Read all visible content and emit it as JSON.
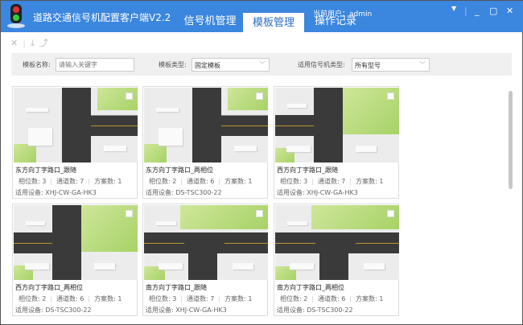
{
  "header": {
    "title": "道路交通信号机配置客户端V2.2",
    "tabs": [
      {
        "label": "信号机管理",
        "active": false
      },
      {
        "label": "模板管理",
        "active": true
      },
      {
        "label": "操作记录",
        "active": false
      }
    ],
    "current_user_label": "当前用户：",
    "user": "admin",
    "accent": "#3b86de"
  },
  "toolbar": {
    "icons": [
      "close-icon",
      "import-icon",
      "export-icon"
    ]
  },
  "filter": {
    "name_label": "模板名称:",
    "name_placeholder": "请输入关键字",
    "type_label": "模板类型:",
    "type_value": "固定模板",
    "device_type_label": "适用信号机类型:",
    "device_type_value": "所有型号"
  },
  "stat_labels": {
    "phases": "相位数: ",
    "channels": "通道数: ",
    "plans": "方案数: ",
    "device": "适用设备: "
  },
  "cards": [
    {
      "title": "东方向丁字路口_跟随",
      "phases": "3",
      "channels": "7",
      "plans": "1",
      "device": "XHJ-CW-GA-HK3",
      "map": "east-t-junction"
    },
    {
      "title": "东方向丁字路口_两相位",
      "phases": "2",
      "channels": "6",
      "plans": "1",
      "device": "DS-TSC300-22",
      "map": "east-t-junction"
    },
    {
      "title": "西方向丁字路口_跟随",
      "phases": "3",
      "channels": "7",
      "plans": "1",
      "device": "XHJ-CW-GA-HK3",
      "map": "west-t-junction"
    },
    {
      "title": "西方向丁字路口_两相位",
      "phases": "2",
      "channels": "6",
      "plans": "1",
      "device": "DS-TSC300-22",
      "map": "west-t-junction"
    },
    {
      "title": "南方向丁字路口_跟随",
      "phases": "3",
      "channels": "7",
      "plans": "1",
      "device": "XHJ-CW-GA-HK3",
      "map": "south-t-junction"
    },
    {
      "title": "南方向丁字路口_两相位",
      "phases": "2",
      "channels": "6",
      "plans": "1",
      "device": "DS-TSC300-22",
      "map": "south-t-junction"
    }
  ]
}
